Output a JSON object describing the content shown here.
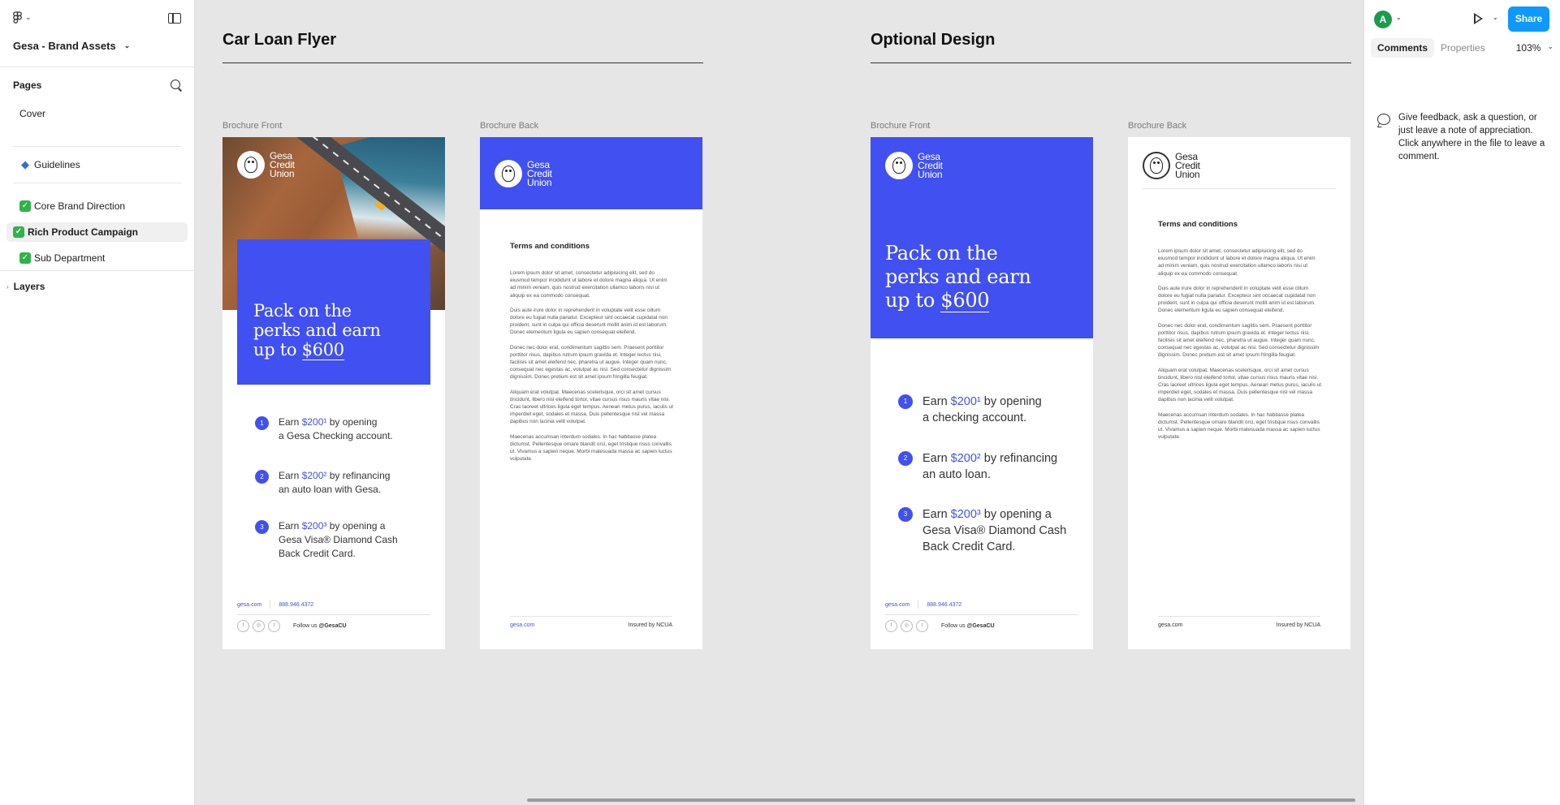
{
  "file": {
    "name": "Gesa - Brand Assets"
  },
  "left_panel": {
    "pages_title": "Pages",
    "pages": [
      {
        "label": "Cover",
        "emoji": ""
      },
      {
        "label": "Guidelines",
        "emoji": "◆"
      },
      {
        "label": "Core Brand Direction",
        "emoji": "✓"
      },
      {
        "label": "Rich Product Campaign",
        "emoji": "✓"
      },
      {
        "label": "Sub Department",
        "emoji": "✓"
      }
    ],
    "layers_title": "Layers"
  },
  "right_panel": {
    "avatar_initial": "A",
    "share_label": "Share",
    "tabs": [
      "Comments",
      "Properties"
    ],
    "zoom": "103%",
    "comment_hint": "Give feedback, ask a question, or just leave a note of appreciation. Click anywhere in the file to leave a comment."
  },
  "canvas": {
    "sections": [
      {
        "title": "Car Loan Flyer",
        "front_label": "Brochure Front",
        "back_label": "Brochure Back"
      },
      {
        "title": "Optional Design",
        "front_label": "Brochure Front",
        "back_label": "Brochure Back"
      }
    ],
    "brand": {
      "line1": "Gesa",
      "line2": "Credit",
      "line3": "Union"
    },
    "headline": {
      "line1": "Pack on the",
      "line2": "perks and earn",
      "line3_prefix": "up to ",
      "amount": "$600"
    },
    "steps_a": [
      {
        "num": "1",
        "pre": "Earn ",
        "amount": "$200¹",
        "post": " by opening",
        "line2": "a Gesa Checking account.",
        "line3": ""
      },
      {
        "num": "2",
        "pre": "Earn ",
        "amount": "$200²",
        "post": " by refinancing",
        "line2": "an auto loan with Gesa.",
        "line3": ""
      },
      {
        "num": "3",
        "pre": "Earn ",
        "amount": "$200³",
        "post": " by opening a",
        "line2": "Gesa Visa® Diamond Cash",
        "line3": "Back Credit Card."
      }
    ],
    "steps_b": [
      {
        "num": "1",
        "pre": "Earn ",
        "amount": "$200¹",
        "post": " by opening",
        "line2": "a checking account.",
        "line3": ""
      },
      {
        "num": "2",
        "pre": "Earn ",
        "amount": "$200²",
        "post": " by refinancing",
        "line2": "an auto loan.",
        "line3": ""
      },
      {
        "num": "3",
        "pre": "Earn ",
        "amount": "$200³",
        "post": " by opening a",
        "line2": "Gesa Visa® Diamond Cash",
        "line3": "Back Credit Card."
      }
    ],
    "footer": {
      "url": "gesa.com",
      "phone": "888.946.4372",
      "follow_prefix": "Follow us ",
      "handle": "@GesaCU",
      "insured": "Insured by NCUA"
    },
    "social_icons": [
      "f",
      "◎",
      "t"
    ],
    "terms": {
      "title": "Terms and conditions",
      "paragraphs": [
        "Lorem ipsum dolor sit amet, consectetur adipisicing elit, sed do eiusmod tempor incididunt ut labore et dolore magna aliqua. Ut enim ad minim veniam, quis nostrud exercitation ullamco laboris nisi ut aliquip ex ea commodo consequat.",
        "Duis aute irure dolor in reprehenderit in voluptate velit esse cillum dolore eu fugiat nulla pariatur. Excepteur sint occaecat cupidatat non proident, sunt in culpa qui officia deserunt mollit anim id est laborum. Donec elementum ligula eu sapien consequat eleifend.",
        "Donec nec dolor erat, condimentum sagittis sem. Praesent porttitor porttitor risus, dapibus rutrum ipsum gravida et. Integer lectus nisi, facilisis sit amet eleifend nec, pharetra ut augue. Integer quam nunc, consequat nec egestas ac, volutpat ac nisi. Sed consectetur dignissim dignissim. Donec pretium est sit amet ipsum fringilla feugiat.",
        "Aliquam erat volutpat. Maecenas scelerisque, orci sit amet cursus tincidunt, libero nisl eleifend tortor, vitae cursus risus mauris vitae nisi. Cras laoreet ultrices ligula eget tempus. Aenean metus purus, iaculis ut imperdiet eget, sodales et massa. Duis pellentesque nisl vel massa dapibus non lacinia velit volutpat.",
        "Maecenas accumsan interdum sodales. In hac habitasse platea dictumst. Pellentesque ornare blandit orci, eget tristique risus convallis ut. Vivamus a sapien neque. Morbi malesuada massa ac sapien luctus vulputate."
      ]
    }
  },
  "colors": {
    "accent": "#4150f0",
    "share": "#0d99ff",
    "avatar": "#1a9c4b"
  }
}
